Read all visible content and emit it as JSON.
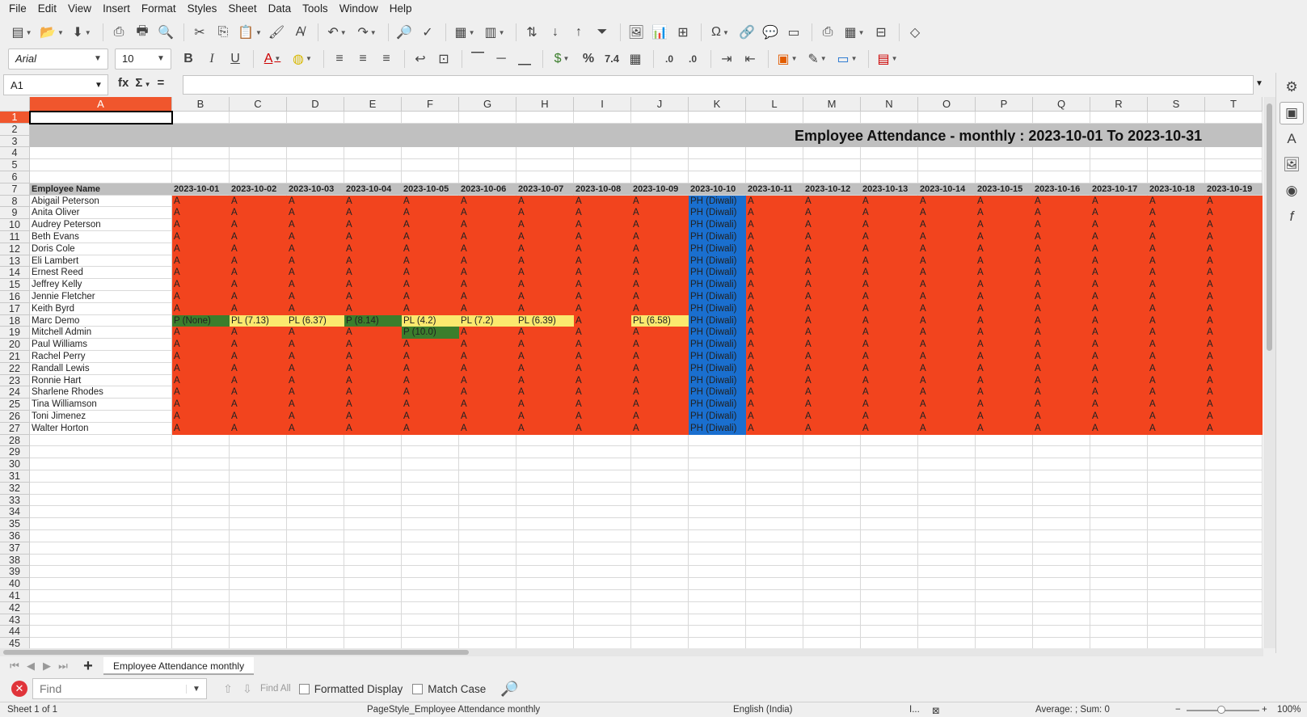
{
  "menu": [
    "File",
    "Edit",
    "View",
    "Insert",
    "Format",
    "Styles",
    "Sheet",
    "Data",
    "Tools",
    "Window",
    "Help"
  ],
  "toolbar": {
    "font_name": "Arial",
    "font_size": "10"
  },
  "formula_bar": {
    "name_box": "A1",
    "fx": "fx",
    "sigma": "Σ",
    "equals": "=",
    "content": ""
  },
  "sheet": {
    "title": "Employee Attendance - monthly : 2023-10-01 To 2023-10-31",
    "name_header": "Employee Name",
    "columns": [
      "A",
      "B",
      "C",
      "D",
      "E",
      "F",
      "G",
      "H",
      "I",
      "J",
      "K",
      "L",
      "M",
      "N",
      "O",
      "P",
      "Q",
      "R",
      "S",
      "T"
    ],
    "dates": [
      "2023-10-01",
      "2023-10-02",
      "2023-10-03",
      "2023-10-04",
      "2023-10-05",
      "2023-10-06",
      "2023-10-07",
      "2023-10-08",
      "2023-10-09",
      "2023-10-10",
      "2023-10-11",
      "2023-10-12",
      "2023-10-13",
      "2023-10-14",
      "2023-10-15",
      "2023-10-16",
      "2023-10-17",
      "2023-10-18",
      "2023-10-19"
    ],
    "rows": [
      {
        "name": "Abigail Peterson",
        "cells": [
          "A",
          "A",
          "A",
          "A",
          "A",
          "A",
          "A",
          "A",
          "A",
          "PH (Diwali)",
          "A",
          "A",
          "A",
          "A",
          "A",
          "A",
          "A",
          "A",
          "A"
        ]
      },
      {
        "name": "Anita Oliver",
        "cells": [
          "A",
          "A",
          "A",
          "A",
          "A",
          "A",
          "A",
          "A",
          "A",
          "PH (Diwali)",
          "A",
          "A",
          "A",
          "A",
          "A",
          "A",
          "A",
          "A",
          "A"
        ]
      },
      {
        "name": "Audrey Peterson",
        "cells": [
          "A",
          "A",
          "A",
          "A",
          "A",
          "A",
          "A",
          "A",
          "A",
          "PH (Diwali)",
          "A",
          "A",
          "A",
          "A",
          "A",
          "A",
          "A",
          "A",
          "A"
        ]
      },
      {
        "name": "Beth Evans",
        "cells": [
          "A",
          "A",
          "A",
          "A",
          "A",
          "A",
          "A",
          "A",
          "A",
          "PH (Diwali)",
          "A",
          "A",
          "A",
          "A",
          "A",
          "A",
          "A",
          "A",
          "A"
        ]
      },
      {
        "name": "Doris Cole",
        "cells": [
          "A",
          "A",
          "A",
          "A",
          "A",
          "A",
          "A",
          "A",
          "A",
          "PH (Diwali)",
          "A",
          "A",
          "A",
          "A",
          "A",
          "A",
          "A",
          "A",
          "A"
        ]
      },
      {
        "name": "Eli Lambert",
        "cells": [
          "A",
          "A",
          "A",
          "A",
          "A",
          "A",
          "A",
          "A",
          "A",
          "PH (Diwali)",
          "A",
          "A",
          "A",
          "A",
          "A",
          "A",
          "A",
          "A",
          "A"
        ]
      },
      {
        "name": "Ernest Reed",
        "cells": [
          "A",
          "A",
          "A",
          "A",
          "A",
          "A",
          "A",
          "A",
          "A",
          "PH (Diwali)",
          "A",
          "A",
          "A",
          "A",
          "A",
          "A",
          "A",
          "A",
          "A"
        ]
      },
      {
        "name": "Jeffrey Kelly",
        "cells": [
          "A",
          "A",
          "A",
          "A",
          "A",
          "A",
          "A",
          "A",
          "A",
          "PH (Diwali)",
          "A",
          "A",
          "A",
          "A",
          "A",
          "A",
          "A",
          "A",
          "A"
        ]
      },
      {
        "name": "Jennie Fletcher",
        "cells": [
          "A",
          "A",
          "A",
          "A",
          "A",
          "A",
          "A",
          "A",
          "A",
          "PH (Diwali)",
          "A",
          "A",
          "A",
          "A",
          "A",
          "A",
          "A",
          "A",
          "A"
        ]
      },
      {
        "name": "Keith Byrd",
        "cells": [
          "A",
          "A",
          "A",
          "A",
          "A",
          "A",
          "A",
          "A",
          "A",
          "PH (Diwali)",
          "A",
          "A",
          "A",
          "A",
          "A",
          "A",
          "A",
          "A",
          "A"
        ]
      },
      {
        "name": "Marc Demo",
        "cells": [
          "P (None)",
          "PL (7.13)",
          "PL (6.37)",
          "P (8.14)",
          "PL (4.2)",
          "PL (7.2)",
          "PL (6.39)",
          "A",
          "PL (6.58)",
          "PH (Diwali)",
          "A",
          "A",
          "A",
          "A",
          "A",
          "A",
          "A",
          "A",
          "A"
        ]
      },
      {
        "name": "Mitchell Admin",
        "cells": [
          "A",
          "A",
          "A",
          "A",
          "P (10.0)",
          "A",
          "A",
          "A",
          "A",
          "PH (Diwali)",
          "A",
          "A",
          "A",
          "A",
          "A",
          "A",
          "A",
          "A",
          "A"
        ]
      },
      {
        "name": "Paul Williams",
        "cells": [
          "A",
          "A",
          "A",
          "A",
          "A",
          "A",
          "A",
          "A",
          "A",
          "PH (Diwali)",
          "A",
          "A",
          "A",
          "A",
          "A",
          "A",
          "A",
          "A",
          "A"
        ]
      },
      {
        "name": "Rachel Perry",
        "cells": [
          "A",
          "A",
          "A",
          "A",
          "A",
          "A",
          "A",
          "A",
          "A",
          "PH (Diwali)",
          "A",
          "A",
          "A",
          "A",
          "A",
          "A",
          "A",
          "A",
          "A"
        ]
      },
      {
        "name": "Randall Lewis",
        "cells": [
          "A",
          "A",
          "A",
          "A",
          "A",
          "A",
          "A",
          "A",
          "A",
          "PH (Diwali)",
          "A",
          "A",
          "A",
          "A",
          "A",
          "A",
          "A",
          "A",
          "A"
        ]
      },
      {
        "name": "Ronnie Hart",
        "cells": [
          "A",
          "A",
          "A",
          "A",
          "A",
          "A",
          "A",
          "A",
          "A",
          "PH (Diwali)",
          "A",
          "A",
          "A",
          "A",
          "A",
          "A",
          "A",
          "A",
          "A"
        ]
      },
      {
        "name": "Sharlene Rhodes",
        "cells": [
          "A",
          "A",
          "A",
          "A",
          "A",
          "A",
          "A",
          "A",
          "A",
          "PH (Diwali)",
          "A",
          "A",
          "A",
          "A",
          "A",
          "A",
          "A",
          "A",
          "A"
        ]
      },
      {
        "name": "Tina Williamson",
        "cells": [
          "A",
          "A",
          "A",
          "A",
          "A",
          "A",
          "A",
          "A",
          "A",
          "PH (Diwali)",
          "A",
          "A",
          "A",
          "A",
          "A",
          "A",
          "A",
          "A",
          "A"
        ]
      },
      {
        "name": "Toni Jimenez",
        "cells": [
          "A",
          "A",
          "A",
          "A",
          "A",
          "A",
          "A",
          "A",
          "A",
          "PH (Diwali)",
          "A",
          "A",
          "A",
          "A",
          "A",
          "A",
          "A",
          "A",
          "A"
        ]
      },
      {
        "name": "Walter Horton",
        "cells": [
          "A",
          "A",
          "A",
          "A",
          "A",
          "A",
          "A",
          "A",
          "A",
          "PH (Diwali)",
          "A",
          "A",
          "A",
          "A",
          "A",
          "A",
          "A",
          "A",
          "A"
        ]
      }
    ],
    "status_colors": {
      "absent": "#f2441e",
      "public_holiday": "#1a6fcf",
      "paid_leave": "#fbe96e",
      "present": "#3b7e2c",
      "header_band": "#c0c0c0",
      "selection": "#f0562d"
    }
  },
  "tabs": {
    "sheet_name": "Employee Attendance monthly",
    "add": "+"
  },
  "find": {
    "placeholder": "Find",
    "find_all": "Find All",
    "formatted_display": "Formatted Display",
    "match_case": "Match Case"
  },
  "status": {
    "sheet_pos": "Sheet 1 of 1",
    "page_style": "PageStyle_Employee Attendance monthly",
    "language": "English (India)",
    "summary": "Average: ; Sum: 0",
    "zoom": "100%"
  }
}
